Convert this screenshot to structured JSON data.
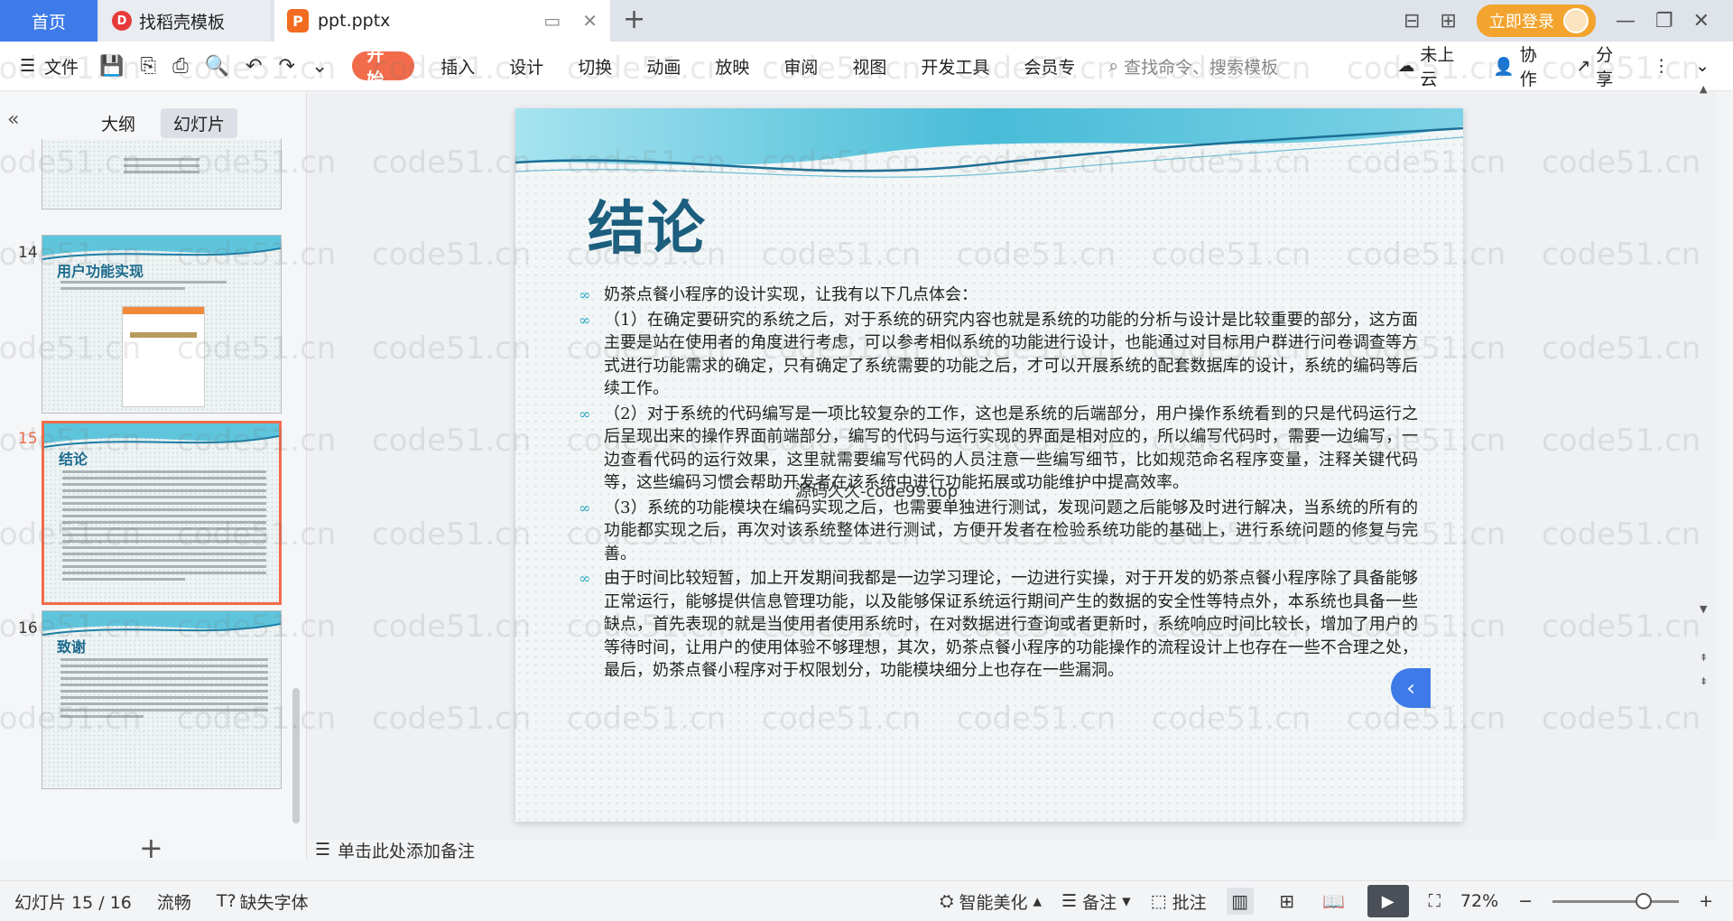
{
  "titlebar": {
    "home_tab": "首页",
    "daoke_tab": "找稻壳模板",
    "daoke_logo": "D",
    "file_tab": "ppt.pptx",
    "file_logo": "P",
    "new_tab_icon": "+",
    "login_label": "立即登录",
    "accent": "#3e7be8"
  },
  "ribbon": {
    "file_menu": "文件",
    "tabs": [
      "开始",
      "插入",
      "设计",
      "切换",
      "动画",
      "放映",
      "审阅",
      "视图",
      "开发工具",
      "会员专"
    ],
    "search_placeholder": "查找命令、搜索模板",
    "cloud": "未上云",
    "collab": "协作",
    "share": "分享",
    "active_color": "#f26b4a"
  },
  "left_panel": {
    "tab_outline": "大纲",
    "tab_slides": "幻灯片",
    "slides": [
      {
        "num": "14",
        "title": "用户功能实现"
      },
      {
        "num": "15",
        "title": "结论"
      },
      {
        "num": "16",
        "title": "致谢"
      }
    ]
  },
  "slide": {
    "title": "结论",
    "overlay_text": "源码久久-code99.top",
    "bullets": [
      "奶茶点餐小程序的设计实现，让我有以下几点体会：",
      "（1）在确定要研究的系统之后，对于系统的研究内容也就是系统的功能的分析与设计是比较重要的部分，这方面主要是站在使用者的角度进行考虑，可以参考相似系统的功能进行设计，也能通过对目标用户群进行问卷调查等方式进行功能需求的确定，只有确定了系统需要的功能之后，才可以开展系统的配套数据库的设计，系统的编码等后续工作。",
      "（2）对于系统的代码编写是一项比较复杂的工作，这也是系统的后端部分，用户操作系统看到的只是代码运行之后呈现出来的操作界面前端部分，编写的代码与运行实现的界面是相对应的，所以编写代码时，需要一边编写，一边查看代码的运行效果，这里就需要编写代码的人员注意一些编写细节，比如规范命名程序变量，注释关键代码等，这些编码习惯会帮助开发者在该系统中进行功能拓展或功能维护中提高效率。",
      "（3）系统的功能模块在编码实现之后，也需要单独进行测试，发现问题之后能够及时进行解决，当系统的所有的功能都实现之后，再次对该系统整体进行测试，方便开发者在检验系统功能的基础上，进行系统问题的修复与完善。",
      "由于时间比较短暂，加上开发期间我都是一边学习理论，一边进行实操，对于开发的奶茶点餐小程序除了具备能够正常运行，能够提供信息管理功能，以及能够保证系统运行期间产生的数据的安全性等特点外，本系统也具备一些缺点，首先表现的就是当使用者使用系统时，在对数据进行查询或者更新时，系统响应时间比较长，增加了用户的等待时间，让用户的使用体验不够理想，其次，奶茶点餐小程序的功能操作的流程设计上也存在一些不合理之处，最后，奶茶点餐小程序对于权限划分，功能模块细分上也存在一些漏洞。"
    ]
  },
  "notes": {
    "placeholder": "单击此处添加备注"
  },
  "status": {
    "slide_counter": "幻灯片 15 / 16",
    "fluency": "流畅",
    "missing_font": "缺失字体",
    "smart_beautify": "智能美化",
    "notes_btn": "备注",
    "comment_btn": "批注",
    "zoom": "72%",
    "zoom_level": 0.72
  },
  "watermark": "code51.cn"
}
